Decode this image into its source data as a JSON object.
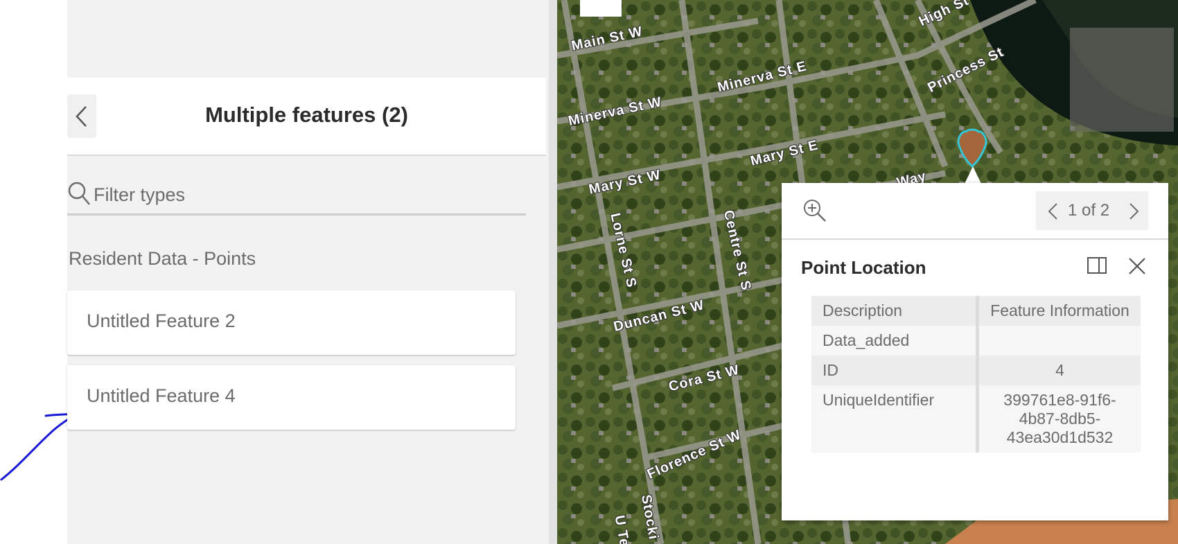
{
  "panel": {
    "title": "Multiple features (2)",
    "filter_placeholder": "Filter types",
    "group_label": "Resident Data - Points",
    "features": [
      "Untitled Feature 2",
      "Untitled Feature 4"
    ]
  },
  "map": {
    "streets": [
      "Main St W",
      "High St",
      "Minerva St E",
      "Princess St",
      "Minerva St W",
      "Mary St E",
      "Mary St W",
      "Way",
      "Lorne St S",
      "Centre St S",
      "Duncan St W",
      "Cora St W",
      "Florence St W",
      "Stocki",
      "U Te"
    ]
  },
  "popup": {
    "pager_text": "1 of 2",
    "title": "Point Location",
    "rows": [
      {
        "key": "Description",
        "value": "Feature Information"
      },
      {
        "key": "Data_added",
        "value": ""
      },
      {
        "key": "ID",
        "value": "4"
      },
      {
        "key": "UniqueIdentifier",
        "value": "399761e8-91f6-4b87-8db5-43ea30d1d532"
      }
    ]
  },
  "colors": {
    "marker": "#a4663a",
    "marker_outline": "#33c6d6",
    "annotation_arrow": "#1a1ad6"
  },
  "icons": [
    "chevron-left-icon",
    "search-icon",
    "zoom-in-icon",
    "chevron-left-icon",
    "chevron-right-icon",
    "dock-icon",
    "close-icon",
    "map-marker-icon"
  ]
}
